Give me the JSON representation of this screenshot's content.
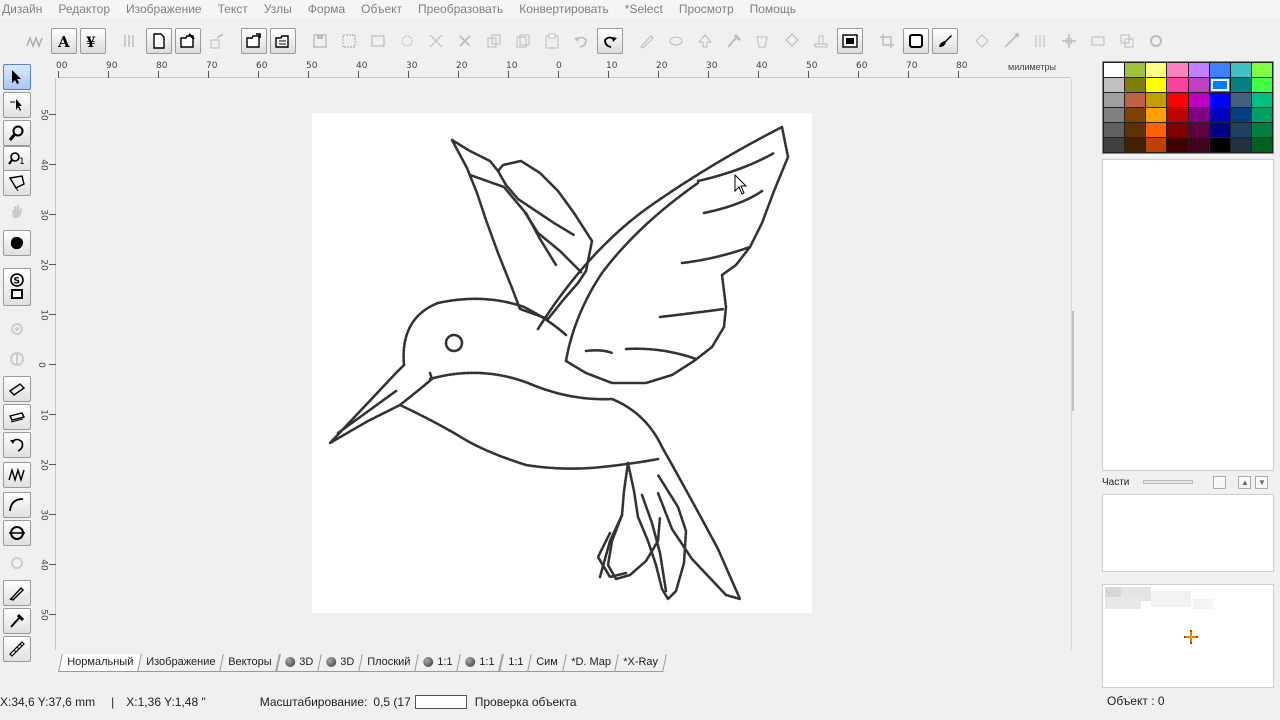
{
  "menu": [
    "Дизайн",
    "Редактор",
    "Изображение",
    "Текст",
    "Узлы",
    "Форма",
    "Объект",
    "Преобразовать",
    "Конвертировать",
    "*Select",
    "Просмотр",
    "Помощь"
  ],
  "toolbar": {
    "icons": [
      "wave-logo-icon",
      "text-a-icon",
      "vector-text-icon",
      "text-columns-icon",
      "new-file-icon",
      "open-file-icon",
      "export-icon",
      "import-icon",
      "save-as-icon",
      "save-icon",
      "frame-icon",
      "rect-icon",
      "node-select-icon",
      "cross-select-icon",
      "cut-icon",
      "copy-icon",
      "copy2-icon",
      "paste-icon",
      "undo-icon",
      "redo-icon",
      "pen-icon",
      "erase-icon",
      "arrow-up-icon",
      "pipette-icon",
      "fill-icon",
      "bucket-icon",
      "stamp-icon",
      "bitmap-icon",
      "crop-icon",
      "outline-icon",
      "brush-icon",
      "tool1-icon",
      "tool2-icon",
      "tool3-icon",
      "tool4-icon",
      "tool5-icon",
      "tool6-icon",
      "tool7-icon"
    ]
  },
  "ruler": {
    "top": [
      "00",
      "90",
      "80",
      "70",
      "60",
      "50",
      "40",
      "30",
      "20",
      "10",
      "0",
      "10",
      "20",
      "30",
      "40",
      "50",
      "60",
      "70",
      "80"
    ],
    "unit": "милиметры",
    "left": [
      "50",
      "40",
      "30",
      "20",
      "10",
      "0",
      "10",
      "20",
      "30",
      "40",
      "50"
    ]
  },
  "tabs": [
    {
      "label": "Нормальный",
      "icon": false
    },
    {
      "label": "Изображение",
      "icon": false
    },
    {
      "label": "Векторы",
      "icon": false
    },
    {
      "label": "3D",
      "icon": true
    },
    {
      "label": "3D",
      "icon": true
    },
    {
      "label": "Плоский",
      "icon": false
    },
    {
      "label": "1:1",
      "icon": true
    },
    {
      "label": "1:1",
      "icon": true
    },
    {
      "label": "1:1",
      "icon": false
    },
    {
      "label": "Сим",
      "icon": false
    },
    {
      "label": "*D. Map",
      "icon": false
    },
    {
      "label": "*X-Ray",
      "icon": false
    }
  ],
  "status": {
    "coords_mm": "X:34,6  Y:37,6 mm",
    "separator": "|",
    "coords_in": "X:1,36  Y:1,48 \"",
    "zoom_label": "Масштабирование:",
    "zoom_value": "0,5 (17",
    "check_label": "Проверка объекта",
    "object_label": "Объект : 0"
  },
  "parts": {
    "label": "Части"
  },
  "palette": [
    "#ffffff",
    "#a0c040",
    "#ffff80",
    "#ff80c0",
    "#c080ff",
    "#4080ff",
    "#40c0c0",
    "#80ff40",
    "#c0c0c0",
    "#808000",
    "#ffff00",
    "#ff40a0",
    "#c040c0",
    "#0080ff",
    "#008080",
    "#40ff40",
    "#a0a0a0",
    "#c06040",
    "#c0a000",
    "#ff0000",
    "#c000c0",
    "#0000ff",
    "#406080",
    "#00c080",
    "#808080",
    "#804000",
    "#ffa000",
    "#c00000",
    "#800080",
    "#0000c0",
    "#004080",
    "#00a060",
    "#606060",
    "#603000",
    "#ff6000",
    "#800000",
    "#600040",
    "#000080",
    "#204060",
    "#008040",
    "#404040",
    "#402000",
    "#c04000",
    "#400000",
    "#400020",
    "#000000",
    "#203040",
    "#006020"
  ],
  "palette_selected": 13
}
